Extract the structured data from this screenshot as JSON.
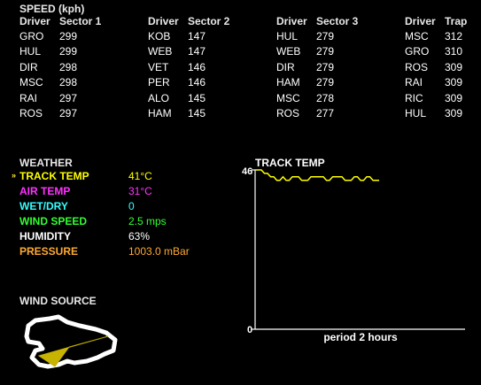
{
  "speed": {
    "title": "SPEED (kph)",
    "sectors": [
      {
        "driver_header": "Driver",
        "value_header": "Sector 1",
        "rows": [
          {
            "driver": "GRO",
            "value": "299"
          },
          {
            "driver": "HUL",
            "value": "299"
          },
          {
            "driver": "DIR",
            "value": "298"
          },
          {
            "driver": "MSC",
            "value": "298"
          },
          {
            "driver": "RAI",
            "value": "297"
          },
          {
            "driver": "ROS",
            "value": "297"
          }
        ]
      },
      {
        "driver_header": "Driver",
        "value_header": "Sector 2",
        "rows": [
          {
            "driver": "KOB",
            "value": "147"
          },
          {
            "driver": "WEB",
            "value": "147"
          },
          {
            "driver": "VET",
            "value": "146"
          },
          {
            "driver": "PER",
            "value": "146"
          },
          {
            "driver": "ALO",
            "value": "145"
          },
          {
            "driver": "HAM",
            "value": "145"
          }
        ]
      },
      {
        "driver_header": "Driver",
        "value_header": "Sector 3",
        "rows": [
          {
            "driver": "HUL",
            "value": "279"
          },
          {
            "driver": "WEB",
            "value": "279"
          },
          {
            "driver": "DIR",
            "value": "279"
          },
          {
            "driver": "HAM",
            "value": "279"
          },
          {
            "driver": "MSC",
            "value": "278"
          },
          {
            "driver": "ROS",
            "value": "277"
          }
        ]
      },
      {
        "driver_header": "Driver",
        "value_header": "Trap",
        "rows": [
          {
            "driver": "MSC",
            "value": "312"
          },
          {
            "driver": "GRO",
            "value": "310"
          },
          {
            "driver": "ROS",
            "value": "309"
          },
          {
            "driver": "RAI",
            "value": "309"
          },
          {
            "driver": "RIC",
            "value": "309"
          },
          {
            "driver": "HUL",
            "value": "309"
          }
        ]
      }
    ]
  },
  "weather": {
    "title": "WEATHER",
    "rows": [
      {
        "label": "TRACK TEMP",
        "value": "41°C",
        "label_color": "#ffff00",
        "value_color": "#ffff00",
        "selected": true
      },
      {
        "label": "AIR TEMP",
        "value": "31°C",
        "label_color": "#ff33ff",
        "value_color": "#ff33ff",
        "selected": false
      },
      {
        "label": "WET/DRY",
        "value": "0",
        "label_color": "#33ffff",
        "value_color": "#33ffff",
        "selected": false
      },
      {
        "label": "WIND SPEED",
        "value": "2.5 mps",
        "label_color": "#33ff33",
        "value_color": "#33ff33",
        "selected": false
      },
      {
        "label": "HUMIDITY",
        "value": "63%",
        "label_color": "#ffffff",
        "value_color": "#ffffff",
        "selected": false
      },
      {
        "label": "PRESSURE",
        "value": "1003.0 mBar",
        "label_color": "#ffaa33",
        "value_color": "#ffaa33",
        "selected": false
      }
    ],
    "selected_marker": "»"
  },
  "wind_source": {
    "title": "WIND SOURCE",
    "icon": "wind-direction-arrow-icon",
    "arrow_color": "#ffff00"
  },
  "chart_data": {
    "type": "line",
    "title": "TRACK TEMP",
    "xlabel": "period 2 hours",
    "ylabel": "",
    "ylim": [
      0,
      46
    ],
    "ytick_labels": [
      "0",
      "46"
    ],
    "line_color": "#ffff00",
    "x": [
      0,
      1,
      2,
      3,
      4,
      5,
      6,
      7,
      8,
      9,
      10,
      11,
      12,
      13,
      14,
      15,
      16,
      17,
      18,
      19,
      20,
      21,
      22,
      23,
      24,
      25,
      26,
      27,
      28,
      29,
      30,
      31,
      32,
      33,
      34,
      35,
      36,
      37,
      38,
      39,
      40
    ],
    "series": [
      {
        "values": [
          46,
          46,
          46,
          45,
          45,
          44,
          44,
          43,
          43,
          44,
          43,
          43,
          44,
          44,
          44,
          43,
          43,
          43,
          44,
          44,
          44,
          44,
          44,
          43,
          43,
          44,
          44,
          44,
          44,
          43,
          43,
          43,
          44,
          44,
          43,
          43,
          44,
          44,
          43,
          43,
          43
        ]
      }
    ]
  }
}
